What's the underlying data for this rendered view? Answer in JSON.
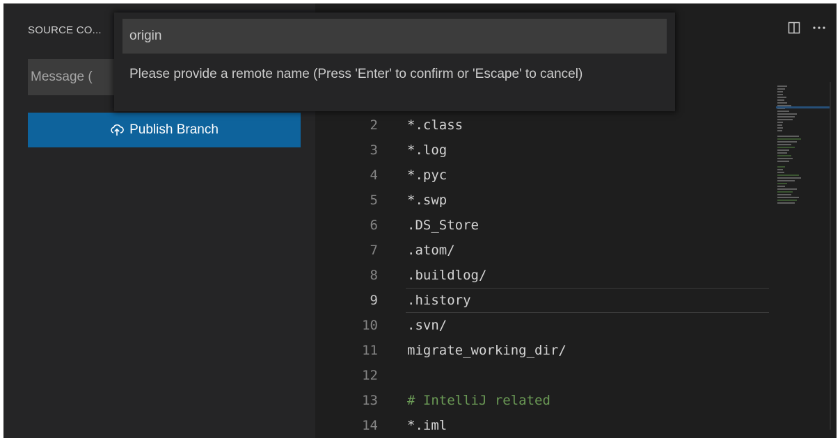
{
  "sidebar": {
    "title": "SOURCE CO...",
    "message_placeholder": "Message (",
    "publish_label": "Publish Branch"
  },
  "quick_input": {
    "value": "origin",
    "message": "Please provide a remote name (Press 'Enter' to confirm or 'Escape' to cancel)"
  },
  "editor": {
    "actions": [
      "split-editor-icon",
      "more-actions-icon"
    ],
    "lines": [
      {
        "num": "2",
        "text": "*.class"
      },
      {
        "num": "3",
        "text": "*.log"
      },
      {
        "num": "4",
        "text": "*.pyc"
      },
      {
        "num": "5",
        "text": "*.swp"
      },
      {
        "num": "6",
        "text": ".DS_Store"
      },
      {
        "num": "7",
        "text": ".atom/"
      },
      {
        "num": "8",
        "text": ".buildlog/"
      },
      {
        "num": "9",
        "text": ".history"
      },
      {
        "num": "10",
        "text": ".svn/"
      },
      {
        "num": "11",
        "text": "migrate_working_dir/"
      },
      {
        "num": "12",
        "text": ""
      },
      {
        "num": "13",
        "text": "# IntelliJ related"
      },
      {
        "num": "14",
        "text": "*.iml"
      }
    ],
    "current_line": "9"
  },
  "colors": {
    "background": "#1e1e1e",
    "sidebar": "#252526",
    "button": "#0e639c",
    "comment": "#6a9955",
    "text": "#d4d4d4"
  }
}
